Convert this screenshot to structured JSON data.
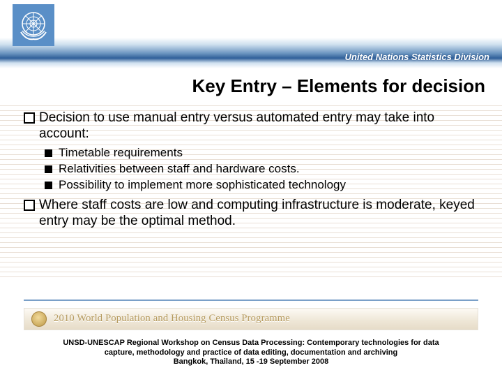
{
  "header": {
    "division": "United Nations Statistics Division"
  },
  "title": "Key Entry – Elements for decision",
  "bullets": {
    "b1": "Decision to use manual entry versus automated entry may take into account:",
    "b1_sub": {
      "s1": "Timetable requirements",
      "s2": "Relativities between staff and hardware costs.",
      "s3": "Possibility to implement more sophisticated technology"
    },
    "b2": "Where staff costs are low and computing infrastructure is moderate, keyed entry may be the optimal method."
  },
  "footer": {
    "programme": "2010 World Population and Housing Census Programme",
    "workshop": {
      "l1": "UNSD-UNESCAP Regional Workshop on Census Data Processing: Contemporary technologies for data",
      "l2": "capture, methodology and practice of data editing, documentation and archiving",
      "l3": "Bangkok, Thailand, 15 -19 September 2008"
    }
  }
}
